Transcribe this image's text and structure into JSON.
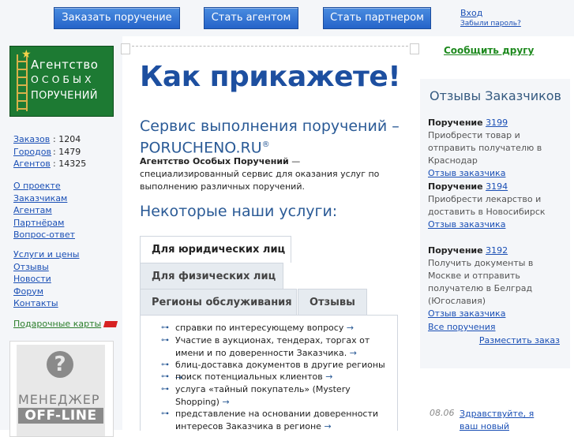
{
  "header": {
    "btn_order": "Заказать поручение",
    "btn_agent": "Стать агентом",
    "btn_partner": "Стать партнером",
    "login": "Вход",
    "forgot": "Забыли пароль?"
  },
  "logo": {
    "line1": "Агентство",
    "line2": "ОСОБЫХ",
    "line3": "ПОРУЧЕНИЙ"
  },
  "stats": [
    {
      "label": "Заказов",
      "value": "1204"
    },
    {
      "label": "Городов",
      "value": "1479"
    },
    {
      "label": "Агентов",
      "value": "14325"
    }
  ],
  "nav1": [
    "О проекте",
    "Заказчикам",
    "Агентам",
    "Партнёрам",
    "Вопрос-ответ"
  ],
  "nav2": [
    "Услуги и цены",
    "Отзывы",
    "Новости",
    "Форум",
    "Контакты"
  ],
  "gift_cards": "Подарочные карты",
  "manager": {
    "line1": "МЕНЕДЖЕР",
    "line2": "OFF-LINE"
  },
  "main": {
    "hero": "Как прикажете!",
    "subhead_line1": "Сервис выполнения поручений –",
    "subhead_line2": "PORUCHENO.RU",
    "reg_mark": "®",
    "desc_bold": "Агентство Особых Поручений",
    "desc_rest": " — специализированный сервис для оказания услуг по выполнению различных поручений.",
    "services_title": "Некоторые наши услуги:",
    "tabs": [
      "Для юридических лиц",
      "Для физических лиц",
      "Регионы обслуживания",
      "Отзывы"
    ],
    "services": [
      "справки по интересующему вопросу",
      "Участие в аукционах, тендерах, торгах от имени и по доверенности Заказчика.",
      "блиц-доставка документов в другие регионы",
      "поиск потенциальных клиентов",
      "услуга «тайный покупатель» (Mystery Shopping)",
      "представление на основании доверенности интересов Заказчика в регионе"
    ]
  },
  "right": {
    "tell_friend": "Сообщить другу",
    "title": "Отзывы Заказчиков",
    "order_word": "Поручение",
    "reviews": [
      {
        "num": "3199",
        "text": "Приобрести товар и отправить получателю в Краснодар",
        "link": "Отзыв заказчика"
      },
      {
        "num": "3194",
        "text": "Приобрести лекарство и доставить в Новосибирск",
        "link": "Отзыв заказчика"
      },
      {
        "num": "3192",
        "text": "Получить документы в Москве и отправить получателю в Белград (Югославия)",
        "link": "Отзыв заказчика"
      }
    ],
    "all_orders": "Все поручения",
    "place_order": "Разместить заказ",
    "news_date": "08.06",
    "news_text": "Здравствуйте, я ваш новый"
  },
  "colors": {
    "accent": "#2563c9",
    "heading": "#1d4fa0",
    "link": "#1a4fb5",
    "green": "#1f8a1f"
  }
}
